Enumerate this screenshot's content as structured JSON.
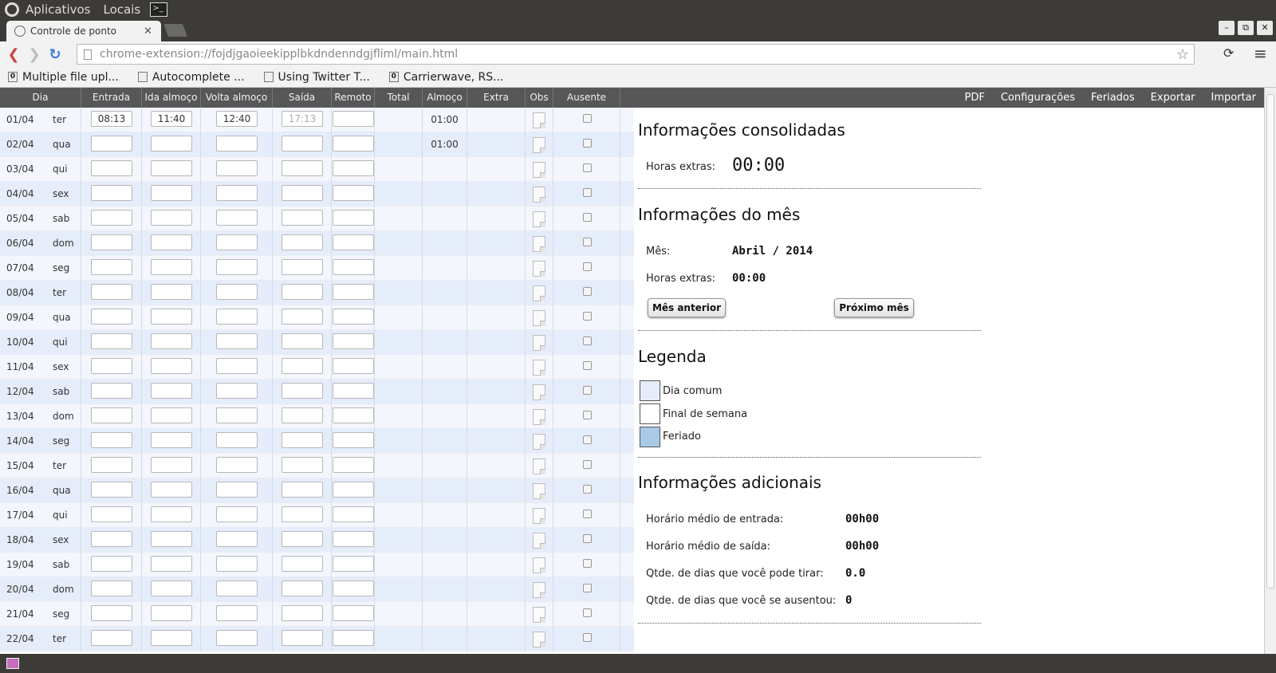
{
  "os_panel": {
    "apps": "Aplicativos",
    "places": "Locais",
    "terminal": ">_"
  },
  "tab": {
    "title": "Controle de ponto",
    "close": "✕"
  },
  "window_controls": [
    "–",
    "⧉",
    "✕"
  ],
  "omnibox": {
    "url": "chrome-extension://fojdjgaoieekipplbkdndenndgjfliml/main.html"
  },
  "bookmarks": [
    {
      "icon": "0",
      "label": "Multiple file upl..."
    },
    {
      "icon": "",
      "label": "Autocomplete ..."
    },
    {
      "icon": "",
      "label": "Using Twitter T..."
    },
    {
      "icon": "0",
      "label": "Carrierwave, RS..."
    }
  ],
  "table_headers": [
    "Dia",
    "Entrada",
    "Ida almoço",
    "Volta almoço",
    "Saída",
    "Remoto",
    "Total",
    "Almoço",
    "Extra",
    "Obs",
    "Ausente"
  ],
  "nav": [
    "PDF",
    "Configurações",
    "Feriados",
    "Exportar",
    "Importar"
  ],
  "rows": [
    {
      "date": "01/04",
      "weekday": "ter",
      "entrada": "08:13",
      "ida": "11:40",
      "volta": "12:40",
      "saida": "17:13",
      "almoco": "01:00"
    },
    {
      "date": "02/04",
      "weekday": "qua",
      "entrada": "",
      "ida": "",
      "volta": "",
      "saida": "",
      "almoco": "01:00"
    },
    {
      "date": "03/04",
      "weekday": "qui"
    },
    {
      "date": "04/04",
      "weekday": "sex"
    },
    {
      "date": "05/04",
      "weekday": "sab"
    },
    {
      "date": "06/04",
      "weekday": "dom"
    },
    {
      "date": "07/04",
      "weekday": "seg"
    },
    {
      "date": "08/04",
      "weekday": "ter"
    },
    {
      "date": "09/04",
      "weekday": "qua"
    },
    {
      "date": "10/04",
      "weekday": "qui"
    },
    {
      "date": "11/04",
      "weekday": "sex"
    },
    {
      "date": "12/04",
      "weekday": "sab"
    },
    {
      "date": "13/04",
      "weekday": "dom"
    },
    {
      "date": "14/04",
      "weekday": "seg"
    },
    {
      "date": "15/04",
      "weekday": "ter"
    },
    {
      "date": "16/04",
      "weekday": "qua"
    },
    {
      "date": "17/04",
      "weekday": "qui"
    },
    {
      "date": "18/04",
      "weekday": "sex"
    },
    {
      "date": "19/04",
      "weekday": "sab"
    },
    {
      "date": "20/04",
      "weekday": "dom"
    },
    {
      "date": "21/04",
      "weekday": "seg"
    },
    {
      "date": "22/04",
      "weekday": "ter"
    }
  ],
  "consolidated": {
    "title": "Informações consolidadas",
    "extra_label": "Horas extras:",
    "extra_value": "00:00"
  },
  "month": {
    "title": "Informações do mês",
    "month_label": "Mês:",
    "month_value": "Abril / 2014",
    "extra_label": "Horas extras:",
    "extra_value": "00:00",
    "prev_button": "Mês anterior",
    "next_button": "Próximo mês"
  },
  "legend": {
    "title": "Legenda",
    "items": [
      {
        "label": "Dia comum",
        "color": "#e6edfa"
      },
      {
        "label": "Final de semana",
        "color": "#ffffff"
      },
      {
        "label": "Feriado",
        "color": "#a8cae6"
      }
    ]
  },
  "additional": {
    "title": "Informações adicionais",
    "items": [
      {
        "label": "Horário médio de entrada:",
        "value": "00h00"
      },
      {
        "label": "Horário médio de saída:",
        "value": "00h00"
      },
      {
        "label": "Qtde. de dias que você pode tirar:",
        "value": "0.0"
      },
      {
        "label": "Qtde. de dias que você se ausentou:",
        "value": "0"
      }
    ]
  }
}
